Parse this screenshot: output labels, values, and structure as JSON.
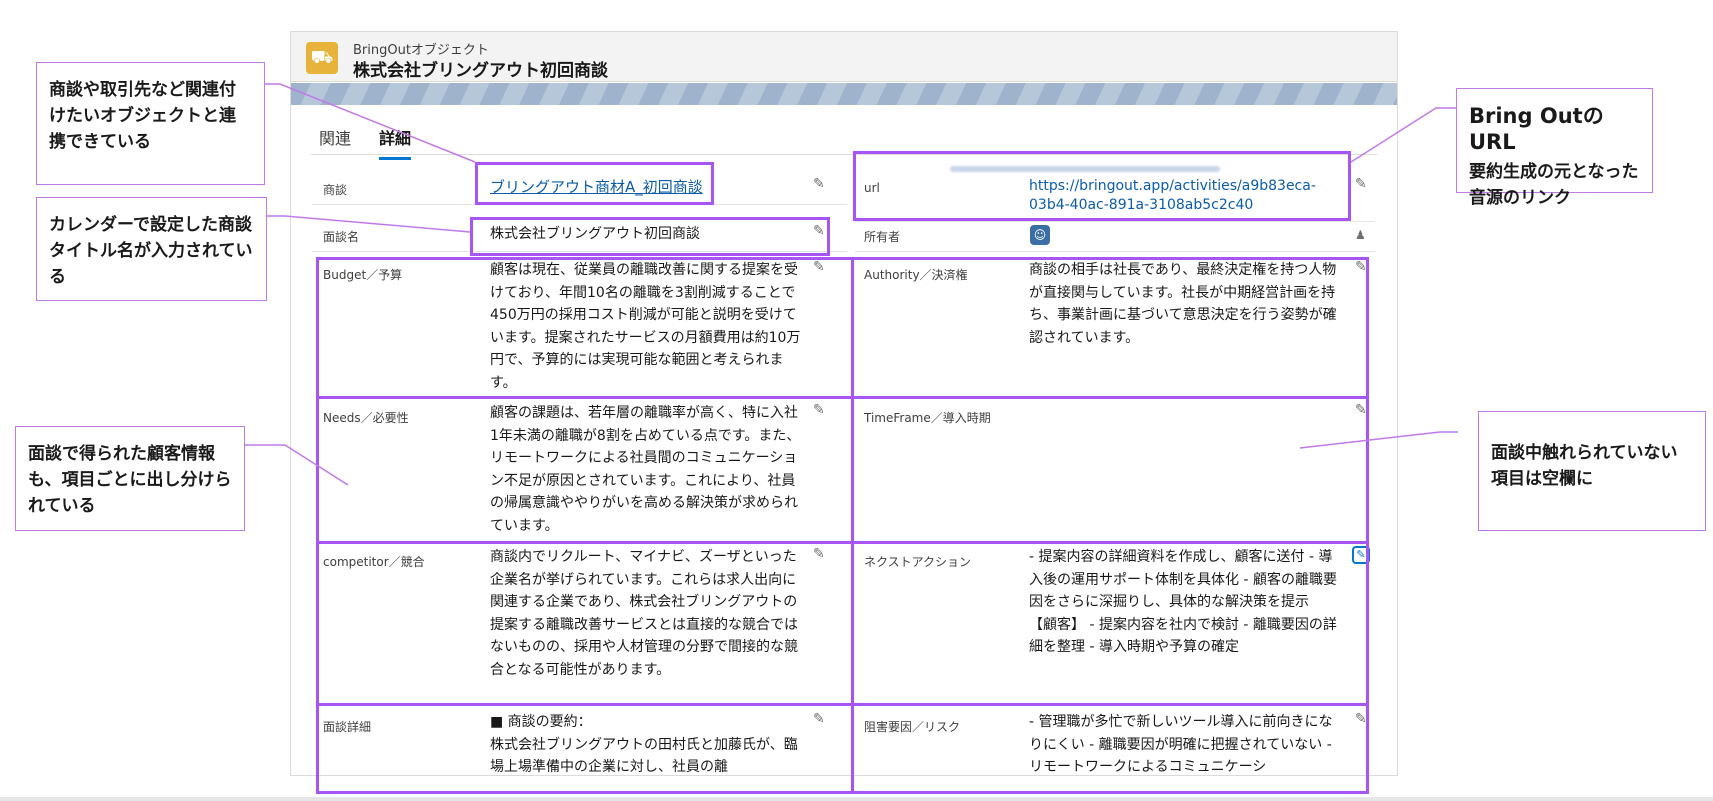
{
  "header": {
    "object_type": "BringOutオブジェクト",
    "record_title": "株式会社ブリングアウト初回商談"
  },
  "tabs": [
    {
      "label": "関連",
      "active": false
    },
    {
      "label": "詳細",
      "active": true
    }
  ],
  "fields": {
    "deal": {
      "label": "商談",
      "value": "ブリングアウト商材A_初回商談"
    },
    "url": {
      "label": "url",
      "value": "https://bringout.app/activities/a9b83eca-03b4-40ac-891a-3108ab5c2c40"
    },
    "meeting_name": {
      "label": "面談名",
      "value": "株式会社ブリングアウト初回商談"
    },
    "owner": {
      "label": "所有者",
      "value": ""
    },
    "budget": {
      "label": "Budget／予算",
      "value": "顧客は現在、従業員の離職改善に関する提案を受けており、年間10名の離職を3割削減することで450万円の採用コスト削減が可能と説明を受けています。提案されたサービスの月額費用は約10万円で、予算的には実現可能な範囲と考えられます。"
    },
    "authority": {
      "label": "Authority／決済権",
      "value": "商談の相手は社長であり、最終決定権を持つ人物が直接関与しています。社長が中期経営計画を持ち、事業計画に基づいて意思決定を行う姿勢が確認されています。"
    },
    "needs": {
      "label": "Needs／必要性",
      "value": "顧客の課題は、若年層の離職率が高く、特に入社1年未満の離職が8割を占めている点です。また、リモートワークによる社員間のコミュニケーション不足が原因とされています。これにより、社員の帰属意識ややりがいを高める解決策が求められています。"
    },
    "timeframe": {
      "label": "TimeFrame／導入時期",
      "value": ""
    },
    "competitor": {
      "label": "competitor／競合",
      "value": "商談内でリクルート、マイナビ、ズーザといった企業名が挙げられています。これらは求人出向に関連する企業であり、株式会社ブリングアウトの提案する離職改善サービスとは直接的な競合ではないものの、採用や人材管理の分野で間接的な競合となる可能性があります。"
    },
    "next_action": {
      "label": "ネクストアクション",
      "value": "- 提案内容の詳細資料を作成し、顧客に送付 - 導入後の運用サポート体制を具体化 - 顧客の離職要因をさらに深掘りし、具体的な解決策を提示 【顧客】 - 提案内容を社内で検討 - 離職要因の詳細を整理 - 導入時期や予算の確定"
    },
    "meeting_detail": {
      "label": "面談詳細",
      "value": "■ 商談の要約：\n株式会社ブリングアウトの田村氏と加藤氏が、臨場上場準備中の企業に対し、社員の離"
    },
    "risk": {
      "label": "阻害要因／リスク",
      "value": "- 管理職が多忙で新しいツール導入に前向きになりにくい - 離職要因が明確に把握されていない - リモートワークによるコミュニケーシ"
    }
  },
  "callouts": {
    "linked_objects": "商談や取引先など関連付けたいオブジェクトと連携できている",
    "calendar_title": "カレンダーで設定した商談タイトル名が入力されている",
    "customer_info": "面談で得られた顧客情報も、項目ごとに出し分けられている",
    "url_title": "Bring OutのURL",
    "url_desc": "要約生成の元となった音源のリンク",
    "empty_fields": "面談中触れられていない項目は空欄に"
  },
  "colors": {
    "highlight": "#a855f7",
    "link": "#0b5cab",
    "object_icon": "#e8b33a"
  },
  "icons": [
    "truck-icon",
    "pencil-icon",
    "owner-avatar-icon",
    "change-owner-icon"
  ]
}
